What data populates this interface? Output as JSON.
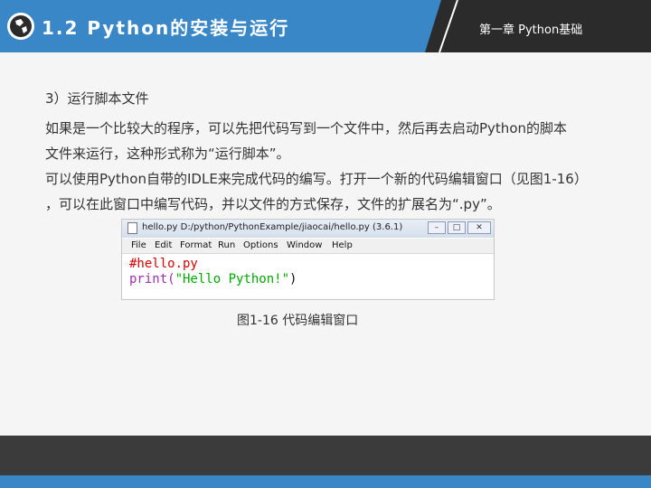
{
  "header": {
    "title": "1.2  Python的安装与运行",
    "chapter": "第一章 Python基础"
  },
  "content": {
    "heading": "3）运行脚本文件",
    "lines": [
      "如果是一个比较大的程序，可以先把代码写到一个文件中，然后再去启动Python的脚本",
      "文件来运行，这种形式称为“运行脚本”。",
      "可以使用Python自带的IDLE来完成代码的编写。打开一个新的代码编辑窗口（见图1-16）",
      "，可以在此窗口中编写代码，并以文件的方式保存，文件的扩展名为“.py”。"
    ]
  },
  "figure": {
    "window_title": "hello.py  D:/python/PythonExample/jiaocai/hello.py (3.6.1)",
    "menu": [
      "File",
      "Edit",
      "Format",
      "Run",
      "Options",
      "Window",
      "Help"
    ],
    "code": {
      "comment": "#hello.py",
      "func": "print(",
      "string": "\"Hello Python!\"",
      "close": ")"
    },
    "colors": {
      "comment": "#dd0000",
      "string": "#00aa00",
      "func": "#9b30b0"
    },
    "caption": "图1-16  代码编辑窗口"
  },
  "colors": {
    "header": "#3a87c8",
    "header_dark": "#2b2b2b",
    "footer": "#3b3b3b"
  }
}
